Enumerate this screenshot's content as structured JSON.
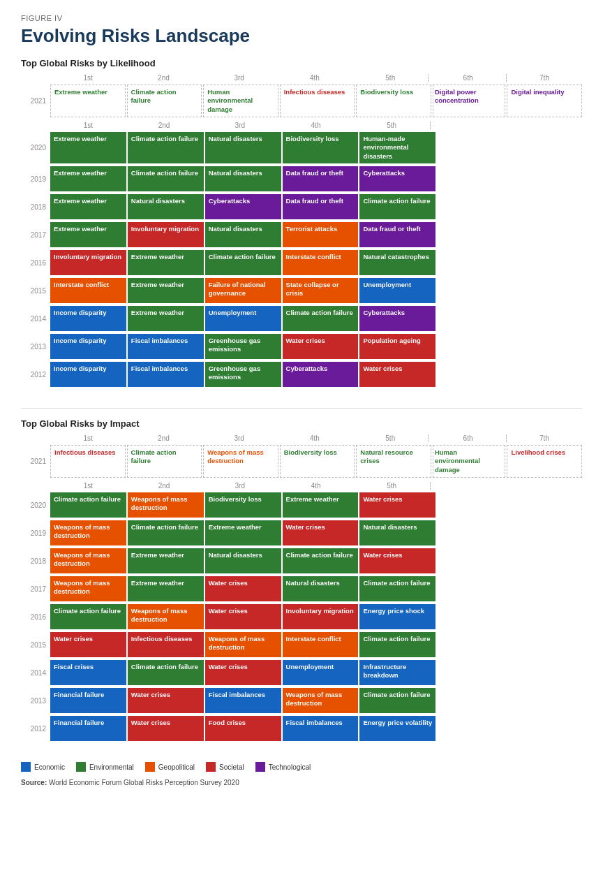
{
  "figure_label": "FIGURE IV",
  "main_title": "Evolving Risks Landscape",
  "section1_title": "Top Global Risks by ",
  "section1_bold": "Likelihood",
  "section2_title": "Top Global Risks by ",
  "section2_bold": "Impact",
  "col_headers": [
    "1st",
    "2nd",
    "3rd",
    "4th",
    "5th",
    "6th",
    "7th"
  ],
  "likelihood": {
    "year2021": [
      {
        "label": "Extreme weather",
        "color": "green",
        "dashed": true
      },
      {
        "label": "Climate action failure",
        "color": "green",
        "dashed": true
      },
      {
        "label": "Human environmental damage",
        "color": "green",
        "dashed": true
      },
      {
        "label": "Infectious diseases",
        "color": "red",
        "dashed": true
      },
      {
        "label": "Biodiversity loss",
        "color": "green",
        "dashed": true
      },
      {
        "label": "Digital power concentration",
        "color": "purple",
        "dashed": true
      },
      {
        "label": "Digital inequality",
        "color": "purple",
        "dashed": true
      }
    ],
    "rows": [
      {
        "year": "2020",
        "cells": [
          {
            "label": "Extreme weather",
            "color": "green"
          },
          {
            "label": "Climate action failure",
            "color": "green"
          },
          {
            "label": "Natural disasters",
            "color": "green"
          },
          {
            "label": "Biodiversity loss",
            "color": "green"
          },
          {
            "label": "Human-made environmental disasters",
            "color": "green"
          }
        ]
      },
      {
        "year": "2019",
        "cells": [
          {
            "label": "Extreme weather",
            "color": "green"
          },
          {
            "label": "Climate action failure",
            "color": "green"
          },
          {
            "label": "Natural disasters",
            "color": "green"
          },
          {
            "label": "Data fraud or theft",
            "color": "purple"
          },
          {
            "label": "Cyberattacks",
            "color": "purple"
          }
        ]
      },
      {
        "year": "2018",
        "cells": [
          {
            "label": "Extreme weather",
            "color": "green"
          },
          {
            "label": "Natural disasters",
            "color": "green"
          },
          {
            "label": "Cyberattacks",
            "color": "purple"
          },
          {
            "label": "Data fraud or theft",
            "color": "purple"
          },
          {
            "label": "Climate action failure",
            "color": "green"
          }
        ]
      },
      {
        "year": "2017",
        "cells": [
          {
            "label": "Extreme weather",
            "color": "green"
          },
          {
            "label": "Involuntary migration",
            "color": "red"
          },
          {
            "label": "Natural disasters",
            "color": "green"
          },
          {
            "label": "Terrorist attacks",
            "color": "orange"
          },
          {
            "label": "Data fraud or theft",
            "color": "purple"
          }
        ]
      },
      {
        "year": "2016",
        "cells": [
          {
            "label": "Involuntary migration",
            "color": "red"
          },
          {
            "label": "Extreme weather",
            "color": "green"
          },
          {
            "label": "Climate action failure",
            "color": "green"
          },
          {
            "label": "Interstate conflict",
            "color": "orange"
          },
          {
            "label": "Natural catastrophes",
            "color": "green"
          }
        ]
      },
      {
        "year": "2015",
        "cells": [
          {
            "label": "Interstate conflict",
            "color": "orange"
          },
          {
            "label": "Extreme weather",
            "color": "green"
          },
          {
            "label": "Failure of national governance",
            "color": "orange"
          },
          {
            "label": "State collapse or crisis",
            "color": "orange"
          },
          {
            "label": "Unemployment",
            "color": "blue"
          }
        ]
      },
      {
        "year": "2014",
        "cells": [
          {
            "label": "Income disparity",
            "color": "blue"
          },
          {
            "label": "Extreme weather",
            "color": "green"
          },
          {
            "label": "Unemployment",
            "color": "blue"
          },
          {
            "label": "Climate action failure",
            "color": "green"
          },
          {
            "label": "Cyberattacks",
            "color": "purple"
          }
        ]
      },
      {
        "year": "2013",
        "cells": [
          {
            "label": "Income disparity",
            "color": "blue"
          },
          {
            "label": "Fiscal imbalances",
            "color": "blue"
          },
          {
            "label": "Greenhouse gas emissions",
            "color": "green"
          },
          {
            "label": "Water crises",
            "color": "red"
          },
          {
            "label": "Population ageing",
            "color": "red"
          }
        ]
      },
      {
        "year": "2012",
        "cells": [
          {
            "label": "Income disparity",
            "color": "blue"
          },
          {
            "label": "Fiscal imbalances",
            "color": "blue"
          },
          {
            "label": "Greenhouse gas emissions",
            "color": "green"
          },
          {
            "label": "Cyberattacks",
            "color": "purple"
          },
          {
            "label": "Water crises",
            "color": "red"
          }
        ]
      }
    ]
  },
  "impact": {
    "year2021": [
      {
        "label": "Infectious diseases",
        "color": "red",
        "dashed": true
      },
      {
        "label": "Climate action failure",
        "color": "green",
        "dashed": true
      },
      {
        "label": "Weapons of mass destruction",
        "color": "orange",
        "dashed": true
      },
      {
        "label": "Biodiversity loss",
        "color": "green",
        "dashed": true
      },
      {
        "label": "Natural resource crises",
        "color": "green",
        "dashed": true
      },
      {
        "label": "Human environmental damage",
        "color": "green",
        "dashed": true
      },
      {
        "label": "Livelihood crises",
        "color": "red",
        "dashed": true
      }
    ],
    "rows": [
      {
        "year": "2020",
        "cells": [
          {
            "label": "Climate action failure",
            "color": "green"
          },
          {
            "label": "Weapons of mass destruction",
            "color": "orange"
          },
          {
            "label": "Biodiversity loss",
            "color": "green"
          },
          {
            "label": "Extreme weather",
            "color": "green"
          },
          {
            "label": "Water crises",
            "color": "red"
          }
        ]
      },
      {
        "year": "2019",
        "cells": [
          {
            "label": "Weapons of mass destruction",
            "color": "orange"
          },
          {
            "label": "Climate action failure",
            "color": "green"
          },
          {
            "label": "Extreme weather",
            "color": "green"
          },
          {
            "label": "Water crises",
            "color": "red"
          },
          {
            "label": "Natural disasters",
            "color": "green"
          }
        ]
      },
      {
        "year": "2018",
        "cells": [
          {
            "label": "Weapons of mass destruction",
            "color": "orange"
          },
          {
            "label": "Extreme weather",
            "color": "green"
          },
          {
            "label": "Natural disasters",
            "color": "green"
          },
          {
            "label": "Climate action failure",
            "color": "green"
          },
          {
            "label": "Water crises",
            "color": "red"
          }
        ]
      },
      {
        "year": "2017",
        "cells": [
          {
            "label": "Weapons of mass destruction",
            "color": "orange"
          },
          {
            "label": "Extreme weather",
            "color": "green"
          },
          {
            "label": "Water crises",
            "color": "red"
          },
          {
            "label": "Natural disasters",
            "color": "green"
          },
          {
            "label": "Climate action failure",
            "color": "green"
          }
        ]
      },
      {
        "year": "2016",
        "cells": [
          {
            "label": "Climate action failure",
            "color": "green"
          },
          {
            "label": "Weapons of mass destruction",
            "color": "orange"
          },
          {
            "label": "Water crises",
            "color": "red"
          },
          {
            "label": "Involuntary migration",
            "color": "red"
          },
          {
            "label": "Energy price shock",
            "color": "blue"
          }
        ]
      },
      {
        "year": "2015",
        "cells": [
          {
            "label": "Water crises",
            "color": "red"
          },
          {
            "label": "Infectious diseases",
            "color": "red"
          },
          {
            "label": "Weapons of mass destruction",
            "color": "orange"
          },
          {
            "label": "Interstate conflict",
            "color": "orange"
          },
          {
            "label": "Climate action failure",
            "color": "green"
          }
        ]
      },
      {
        "year": "2014",
        "cells": [
          {
            "label": "Fiscal crises",
            "color": "blue"
          },
          {
            "label": "Climate action failure",
            "color": "green"
          },
          {
            "label": "Water crises",
            "color": "red"
          },
          {
            "label": "Unemployment",
            "color": "blue"
          },
          {
            "label": "Infrastructure breakdown",
            "color": "blue"
          }
        ]
      },
      {
        "year": "2013",
        "cells": [
          {
            "label": "Financial failure",
            "color": "blue"
          },
          {
            "label": "Water crises",
            "color": "red"
          },
          {
            "label": "Fiscal imbalances",
            "color": "blue"
          },
          {
            "label": "Weapons of mass destruction",
            "color": "orange"
          },
          {
            "label": "Climate action failure",
            "color": "green"
          }
        ]
      },
      {
        "year": "2012",
        "cells": [
          {
            "label": "Financial failure",
            "color": "blue"
          },
          {
            "label": "Water crises",
            "color": "red"
          },
          {
            "label": "Food crises",
            "color": "red"
          },
          {
            "label": "Fiscal imbalances",
            "color": "blue"
          },
          {
            "label": "Energy price volatility",
            "color": "blue"
          }
        ]
      }
    ]
  },
  "legend": [
    {
      "label": "Economic",
      "color": "#1565c0"
    },
    {
      "label": "Environmental",
      "color": "#2e7d32"
    },
    {
      "label": "Geopolitical",
      "color": "#e65100"
    },
    {
      "label": "Societal",
      "color": "#c62828"
    },
    {
      "label": "Technological",
      "color": "#6a1b9a"
    }
  ],
  "source_text": "Source: ",
  "source_detail": "World Economic Forum Global Risks Perception Survey 2020"
}
